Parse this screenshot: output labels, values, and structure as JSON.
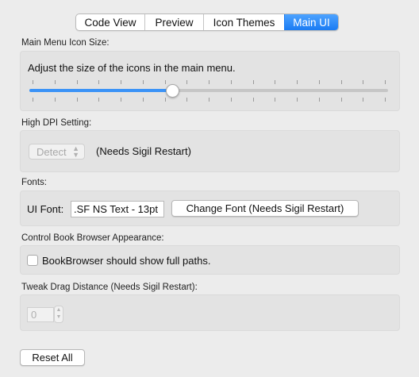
{
  "tabs": [
    {
      "label": "Code View",
      "active": false
    },
    {
      "label": "Preview",
      "active": false
    },
    {
      "label": "Icon Themes",
      "active": false
    },
    {
      "label": "Main UI",
      "active": true
    }
  ],
  "icon_size": {
    "section_label": "Main Menu Icon Size:",
    "description": "Adjust the size of the icons in the main menu.",
    "slider_value_fraction": 0.4,
    "tick_count": 17
  },
  "dpi": {
    "section_label": "High DPI Setting:",
    "select_value": "Detect",
    "note": "(Needs Sigil Restart)"
  },
  "fonts": {
    "section_label": "Fonts:",
    "ui_font_label": "UI Font:",
    "ui_font_value": ".SF NS Text - 13pt",
    "change_button": "Change Font (Needs Sigil Restart)"
  },
  "book_browser": {
    "section_label": "Control Book Browser Appearance:",
    "checkbox_label": "BookBrowser should show full paths.",
    "checked": false
  },
  "drag": {
    "section_label": "Tweak Drag Distance (Needs Sigil Restart):",
    "value": "0"
  },
  "reset_button": "Reset All",
  "colors": {
    "accent": "#1a7bf3",
    "background": "#ececec",
    "group_background": "#e3e3e3"
  }
}
